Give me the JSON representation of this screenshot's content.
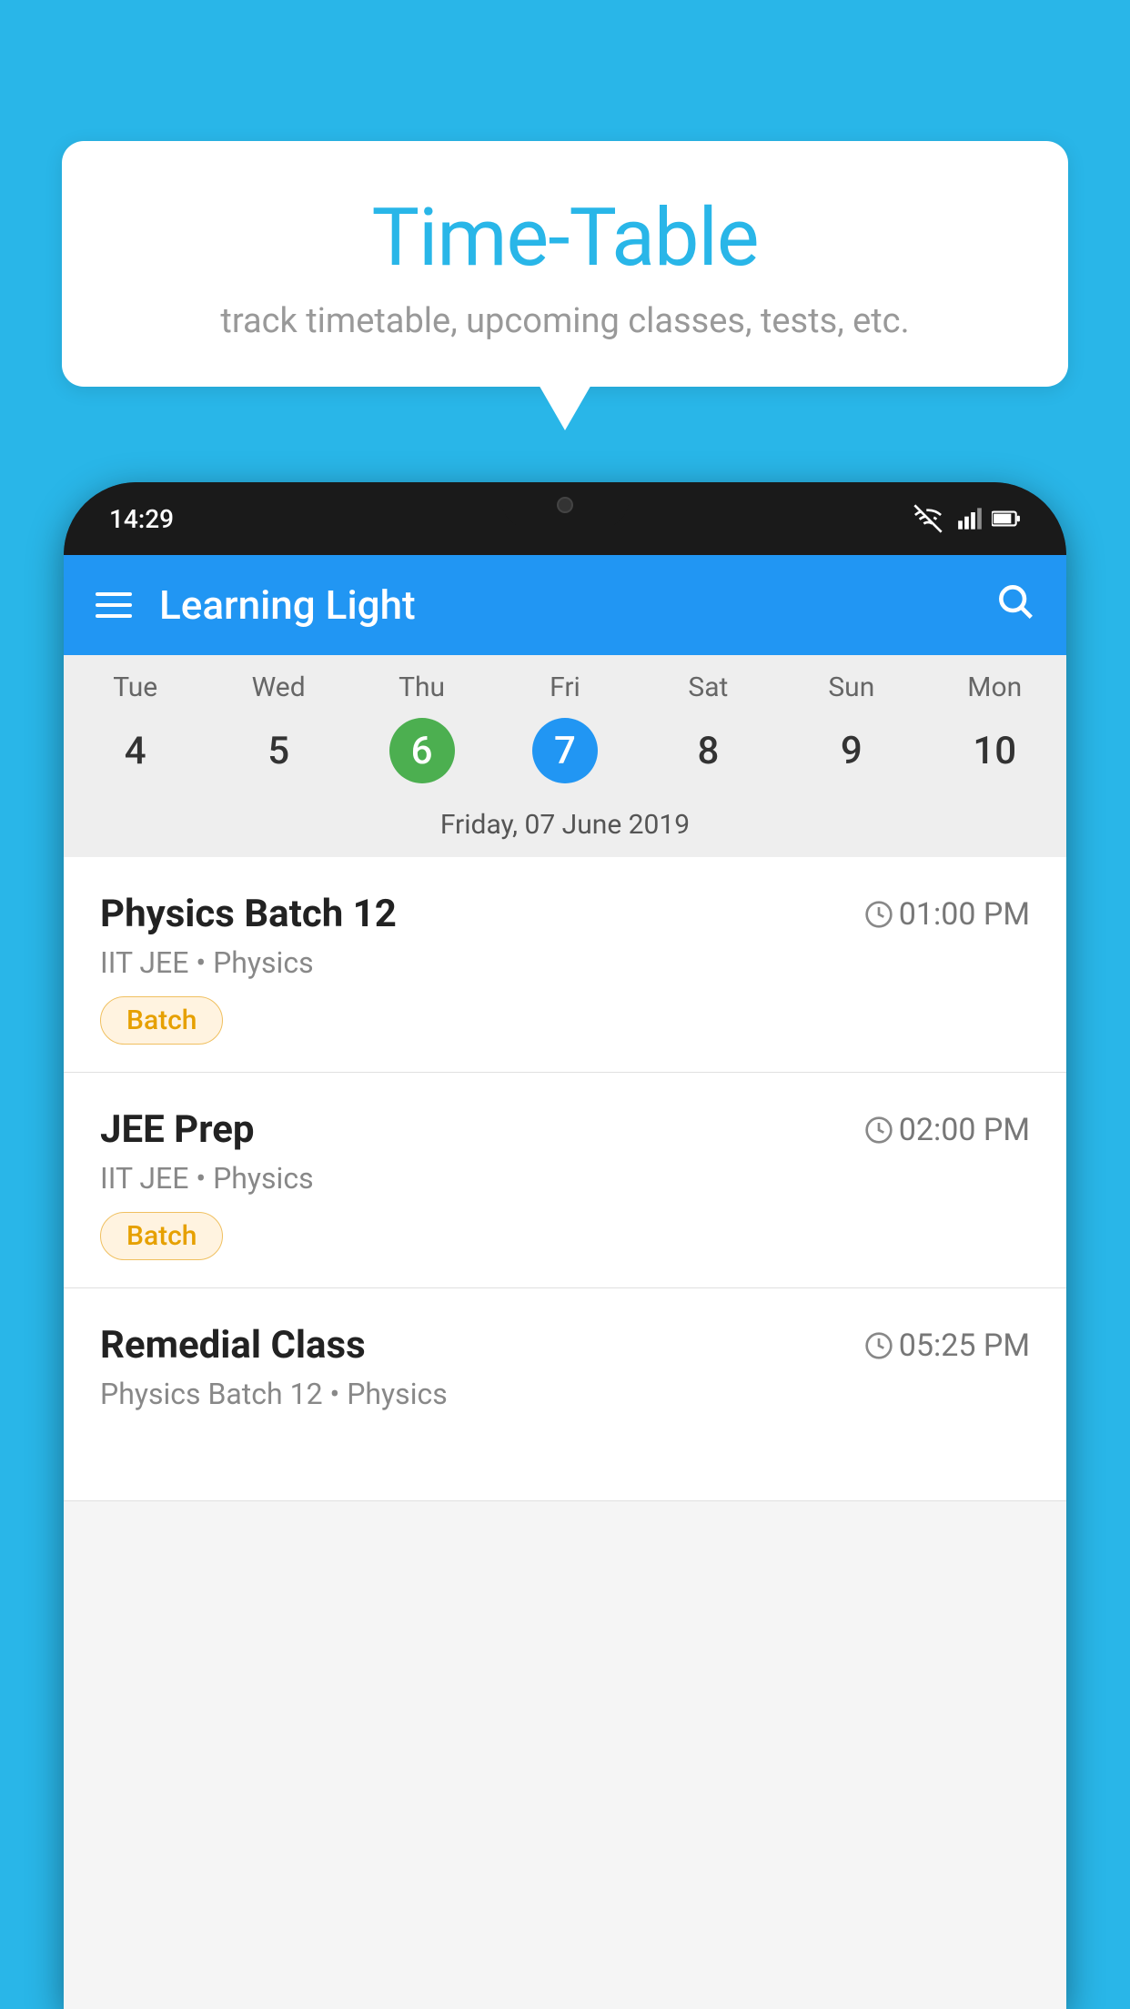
{
  "background_color": "#29b6e8",
  "speech_bubble": {
    "title": "Time-Table",
    "subtitle": "track timetable, upcoming classes, tests, etc."
  },
  "phone": {
    "status_bar": {
      "time": "14:29"
    },
    "app_bar": {
      "title": "Learning Light"
    },
    "calendar": {
      "days": [
        "Tue",
        "Wed",
        "Thu",
        "Fri",
        "Sat",
        "Sun",
        "Mon"
      ],
      "dates": [
        "4",
        "5",
        "6",
        "7",
        "8",
        "9",
        "10"
      ],
      "today_index": 2,
      "selected_index": 3,
      "selected_label": "Friday, 07 June 2019"
    },
    "classes": [
      {
        "name": "Physics Batch 12",
        "time": "01:00 PM",
        "detail": "IIT JEE • Physics",
        "tag": "Batch"
      },
      {
        "name": "JEE Prep",
        "time": "02:00 PM",
        "detail": "IIT JEE • Physics",
        "tag": "Batch"
      },
      {
        "name": "Remedial Class",
        "time": "05:25 PM",
        "detail": "Physics Batch 12 • Physics",
        "tag": null
      }
    ]
  }
}
